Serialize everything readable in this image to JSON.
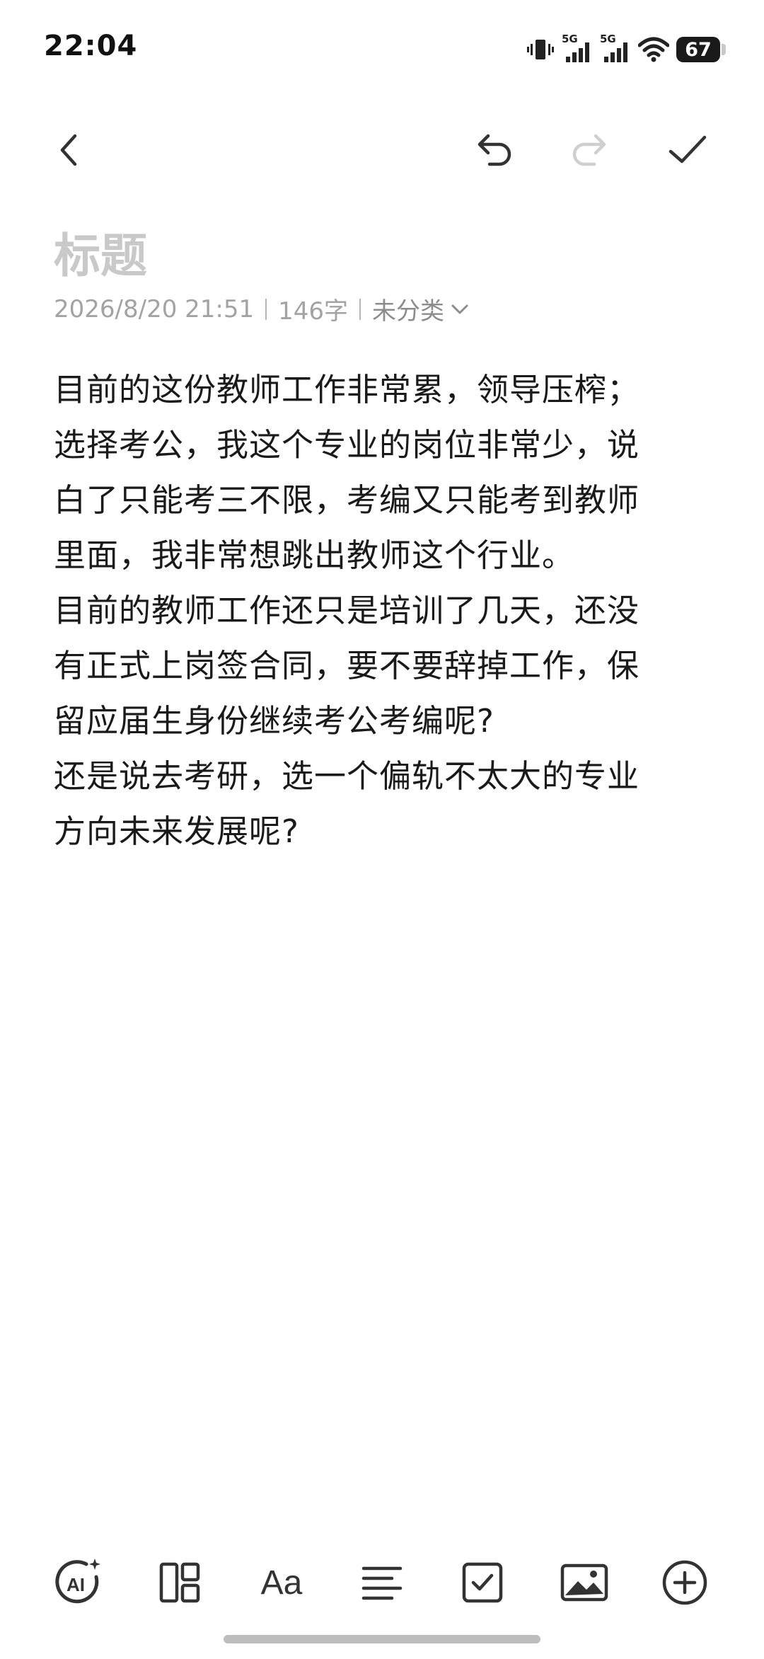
{
  "status_bar": {
    "time": "22:04",
    "signal1_label": "5G",
    "signal2_label": "5G",
    "battery": "67"
  },
  "toolbar": {
    "back_icon": "chevron-left-icon",
    "undo_icon": "undo-icon",
    "redo_icon": "redo-icon",
    "done_icon": "check-icon",
    "redo_enabled": false
  },
  "note": {
    "title_placeholder": "标题",
    "date": "2026/8/20 21:51",
    "word_count": "146字",
    "category": "未分类",
    "lines": [
      "目前的这份教师工作非常累，领导压榨；",
      "选择考公，我这个专业的岗位非常少，说",
      "白了只能考三不限，考编又只能考到教师",
      "里面，我非常想跳出教师这个行业。",
      "目前的教师工作还只是培训了几天，还没",
      "有正式上岗签合同，要不要辞掉工作，保",
      "留应届生身份继续考公考编呢?",
      "还是说去考研，选一个偏轨不太大的专业",
      "方向未来发展呢?"
    ]
  },
  "bottom_bar": {
    "items": [
      {
        "icon": "ai-icon",
        "label": "AI"
      },
      {
        "icon": "layout-icon"
      },
      {
        "icon": "text-format-icon",
        "label": "Aa"
      },
      {
        "icon": "align-icon"
      },
      {
        "icon": "checkbox-icon"
      },
      {
        "icon": "image-icon"
      },
      {
        "icon": "plus-circle-icon"
      }
    ]
  },
  "colors": {
    "text": "#1a1a1a",
    "placeholder": "#c9c9c9",
    "meta": "#a3a3a3",
    "icon": "#333333",
    "disabled_icon": "#cfcfcf"
  }
}
